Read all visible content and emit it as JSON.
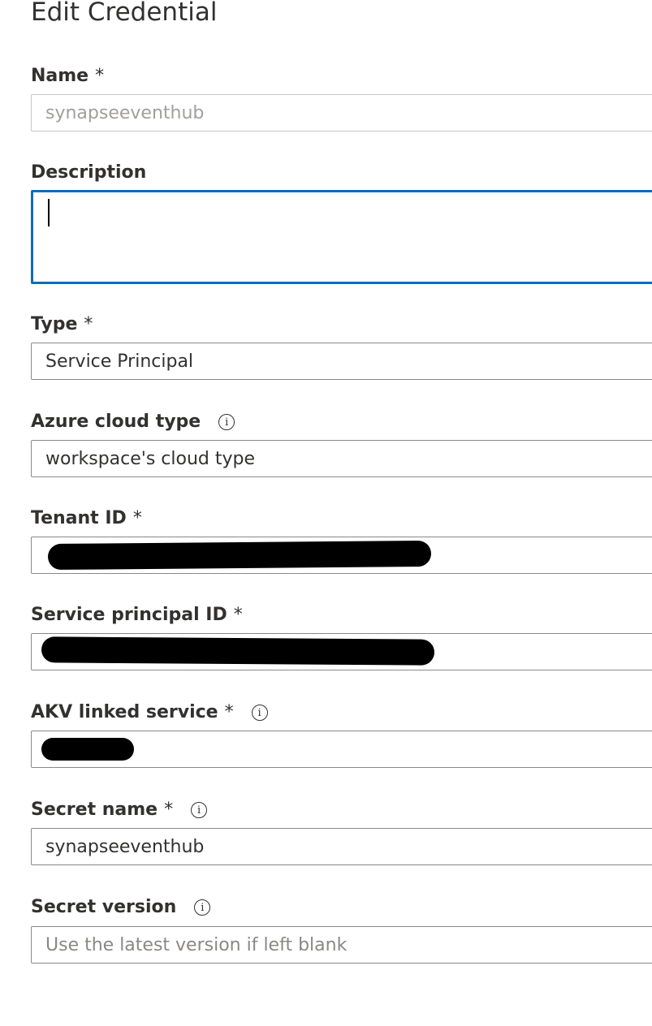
{
  "panel": {
    "title": "Edit Credential"
  },
  "fields": {
    "name": {
      "label": "Name",
      "required": "*",
      "value": "synapseeventhub"
    },
    "description": {
      "label": "Description",
      "value": ""
    },
    "type": {
      "label": "Type",
      "required": "*",
      "value": "Service Principal"
    },
    "azure_cloud_type": {
      "label": "Azure cloud type",
      "info_icon": "info-icon",
      "value": "workspace's cloud type"
    },
    "tenant_id": {
      "label": "Tenant ID",
      "required": "*",
      "value_redacted": true
    },
    "service_principal_id": {
      "label": "Service principal ID",
      "required": "*",
      "value_redacted": true
    },
    "akv_linked_service": {
      "label": "AKV linked service",
      "required": "*",
      "info_icon": "info-icon",
      "value_redacted": true
    },
    "secret_name": {
      "label": "Secret name",
      "required": "*",
      "info_icon": "info-icon",
      "value": "synapseeventhub"
    },
    "secret_version": {
      "label": "Secret version",
      "info_icon": "info-icon",
      "placeholder": "Use the latest version if left blank"
    }
  },
  "colors": {
    "focus_border": "#0f6cbd",
    "input_border": "#8a8886",
    "disabled_text": "#a19f9d",
    "text": "#323130"
  }
}
